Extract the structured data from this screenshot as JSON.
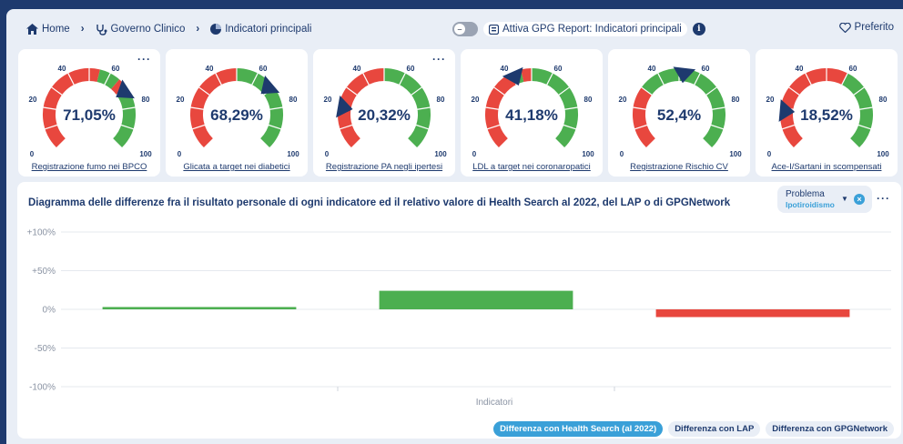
{
  "breadcrumb": {
    "home": "Home",
    "level2": "Governo Clinico",
    "level3": "Indicatori principali"
  },
  "report": {
    "toggle_label": "Attiva GPG Report: Indicatori principali",
    "toggle_state": "off"
  },
  "favorite": {
    "label": "Preferito"
  },
  "gauges": [
    {
      "value_label": "71,05%",
      "value": 71.05,
      "link": "Registrazione fumo nei BPCO",
      "bands": [
        [
          "red",
          0,
          55
        ],
        [
          "green",
          55,
          65
        ],
        [
          "red",
          65,
          70
        ],
        [
          "green",
          70,
          100
        ]
      ]
    },
    {
      "value_label": "68,29%",
      "value": 68.29,
      "link": "Glicata a target nei diabetici",
      "bands": [
        [
          "red",
          0,
          50
        ],
        [
          "green",
          50,
          100
        ]
      ]
    },
    {
      "value_label": "20,32%",
      "value": 20.32,
      "link": "Registrazione PA negli ipertesi",
      "bands": [
        [
          "red",
          0,
          50
        ],
        [
          "green",
          50,
          100
        ]
      ]
    },
    {
      "value_label": "41,18%",
      "value": 41.18,
      "link": "LDL a target nei coronaropatici",
      "bands": [
        [
          "red",
          0,
          40
        ],
        [
          "green",
          40,
          45
        ],
        [
          "red",
          45,
          50
        ],
        [
          "green",
          50,
          100
        ]
      ]
    },
    {
      "value_label": "52,4%",
      "value": 52.4,
      "link": "Registrazione Rischio CV",
      "bands": [
        [
          "red",
          0,
          30
        ],
        [
          "green",
          30,
          100
        ]
      ]
    },
    {
      "value_label": "18,52%",
      "value": 18.52,
      "link": "Ace-I/Sartani in scompensati",
      "bands": [
        [
          "red",
          0,
          60
        ],
        [
          "green",
          60,
          100
        ]
      ]
    }
  ],
  "gauge_ticks": [
    "0",
    "20",
    "40",
    "60",
    "80",
    "100"
  ],
  "colors": {
    "red": "#e8473e",
    "green": "#4caf50",
    "needle": "#1e3a6e",
    "navy": "#1e3a6e",
    "accent": "#3aa0d8"
  },
  "chart_panel": {
    "title": "Diagramma delle differenze fra il risultato personale di ogni indicatore ed il relativo valore di Health Search al 2022, del LAP o di GPGNetwork",
    "problem_label": "Problema",
    "problem_value": "Ipotiroidismo"
  },
  "chart_data": {
    "type": "bar",
    "categories": [
      "",
      "",
      ""
    ],
    "values": [
      3,
      24,
      -10
    ],
    "bar_colors": [
      "green",
      "green",
      "red"
    ],
    "ylim": [
      -100,
      100
    ],
    "yticks": [
      "+100%",
      "+50%",
      "0%",
      "-50%",
      "-100%"
    ],
    "ytick_values": [
      100,
      50,
      0,
      -50,
      -100
    ],
    "xlabel": "Indicatori",
    "ylabel": "",
    "grid": true
  },
  "legend": [
    {
      "label": "Differenza con Health Search (al 2022)",
      "active": true
    },
    {
      "label": "Differenza con LAP",
      "active": false
    },
    {
      "label": "Differenza con GPGNetwork",
      "active": false
    }
  ]
}
